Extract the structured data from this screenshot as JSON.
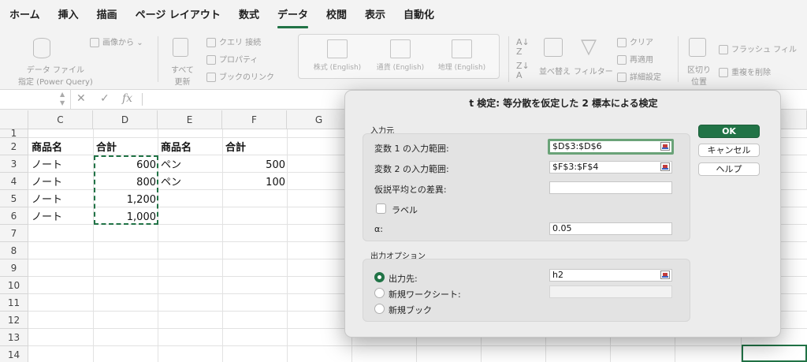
{
  "ribbon_tabs": [
    "ホーム",
    "挿入",
    "描画",
    "ページ レイアウト",
    "数式",
    "データ",
    "校閲",
    "表示",
    "自動化"
  ],
  "active_tab": "データ",
  "ribbon": {
    "get_data_line1": "データ ファイル",
    "get_data_line2": "指定 (Power Query)",
    "from_picture": "画像から",
    "refresh_all_line1": "すべて",
    "refresh_all_line2": "更新",
    "queries": "クエリ",
    "connections": "接続",
    "properties": "プロパティ",
    "workbook_links": "ブックのリンク",
    "stocks": "株式 (English)",
    "currencies": "通貨 (English)",
    "geography": "地理 (English)",
    "sort": "並べ替え",
    "filter": "フィルター",
    "clear": "クリア",
    "reapply": "再適用",
    "advanced": "詳細設定",
    "text_to_columns_line1": "区切り",
    "text_to_columns_line2": "位置",
    "flash_fill": "フラッシュ フィル",
    "remove_duplicates": "重複を削除",
    "az_icon": "A/Z sort icon"
  },
  "formula_bar": {
    "cancel": "✕",
    "enter": "✓",
    "fx": "fx",
    "value": ""
  },
  "grid": {
    "columns": [
      "C",
      "D",
      "E",
      "F",
      "G"
    ],
    "rows": [
      "1",
      "2",
      "3",
      "4",
      "5",
      "6",
      "7",
      "8",
      "9",
      "10",
      "11",
      "12",
      "13",
      "14"
    ],
    "cells": {
      "C2": "商品名",
      "D2": "合計",
      "E2": "商品名",
      "F2": "合計",
      "C3": "ノート",
      "D3": "600",
      "E3": "ペン",
      "F3": "500",
      "C4": "ノート",
      "D4": "800",
      "E4": "ペン",
      "F4": "100",
      "C5": "ノート",
      "D5": "1,200",
      "C6": "ノート",
      "D6": "1,000"
    }
  },
  "dialog": {
    "title": "t 検定: 等分散を仮定した 2 標本による検定",
    "input_group": "入力元",
    "var1_label": "変数 1 の入力範囲:",
    "var1_value": "$D$3:$D$6",
    "var2_label": "変数 2 の入力範囲:",
    "var2_value": "$F$3:$F$4",
    "hypothesized_diff_label": "仮説平均との差異:",
    "hypothesized_diff_value": "",
    "labels_checkbox": "ラベル",
    "alpha_label": "α:",
    "alpha_value": "0.05",
    "output_group": "出力オプション",
    "output_range_label": "出力先:",
    "output_range_value": "h2",
    "new_sheet_label": "新規ワークシート:",
    "new_workbook_label": "新規ブック",
    "ok": "OK",
    "cancel": "キャンセル",
    "help": "ヘルプ"
  },
  "colors": {
    "accent": "#217346"
  }
}
